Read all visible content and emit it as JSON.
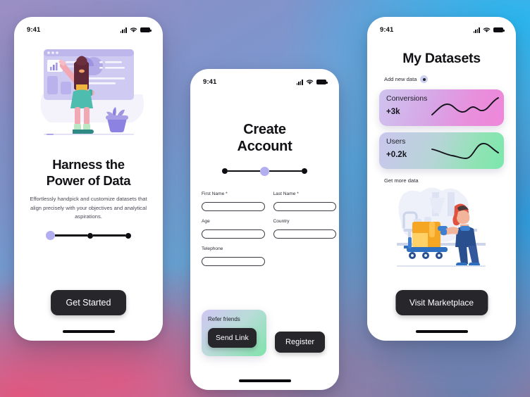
{
  "background": {
    "colors": [
      "#9b8fc4",
      "#2ab6ee",
      "#6aa9da",
      "#e0577f",
      "#6a7fae"
    ]
  },
  "status_bar": {
    "time": "9:41",
    "icons": [
      "signal-bars-icon",
      "wifi-icon",
      "battery-icon"
    ]
  },
  "phone1": {
    "illustration": "woman-at-dashboard-illustration",
    "title": "Harness the\nPower of Data",
    "title_line1": "Harness the",
    "title_line2": "Power of Data",
    "subtitle": "Effortlessly handpick and customize datasets that align precisely with your objectives and analytical aspirations.",
    "stepper": {
      "total": 3,
      "active_index": 0,
      "active_color": "#b3aef0",
      "inactive_color": "#0d0d12"
    },
    "cta_label": "Get Started"
  },
  "phone2": {
    "title_line1": "Create",
    "title_line2": "Account",
    "stepper": {
      "total": 3,
      "active_index": 1,
      "active_color": "#b3aef0",
      "inactive_color": "#0d0d12"
    },
    "form": {
      "fields": [
        {
          "label": "First Name *",
          "value": "",
          "placeholder": ""
        },
        {
          "label": "Last Name *",
          "value": "",
          "placeholder": ""
        },
        {
          "label": "Age",
          "value": "",
          "placeholder": ""
        },
        {
          "label": "Country",
          "value": "",
          "placeholder": ""
        },
        {
          "label": "Telephone",
          "value": "",
          "placeholder": ""
        }
      ]
    },
    "refer_card": {
      "label": "Refer friends",
      "button_label": "Send Link",
      "gradient": [
        "#cfc6f2",
        "#7fe3ab"
      ]
    },
    "register_label": "Register"
  },
  "phone3": {
    "title": "My Datasets",
    "add_new_label": "Add new data",
    "add_new_icon": "add-circle-icon",
    "cards": [
      {
        "name": "Conversions",
        "value": "+3k",
        "gradient": [
          "#cfc4ef",
          "#ef86d9"
        ],
        "sparkline": [
          18,
          12,
          8,
          14,
          20,
          17,
          11,
          14,
          9,
          4
        ]
      },
      {
        "name": "Users",
        "value": "+0.2k",
        "gradient": [
          "#cbc6ee",
          "#7ae8ac"
        ],
        "sparkline": [
          12,
          14,
          17,
          19,
          18,
          20,
          10,
          4,
          6,
          9
        ]
      }
    ],
    "more_label": "Get more data",
    "illustration": "worker-with-cart-illustration",
    "cta_label": "Visit Marketplace"
  }
}
